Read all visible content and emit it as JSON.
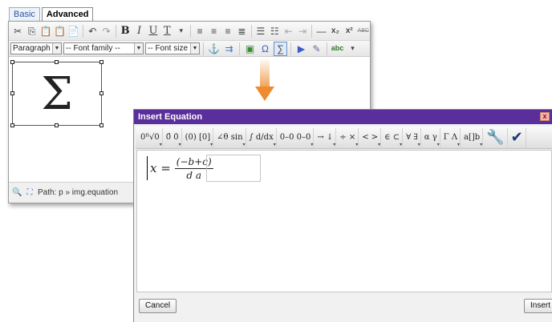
{
  "editor": {
    "tabs": [
      {
        "label": "Basic",
        "active": false
      },
      {
        "label": "Advanced",
        "active": true
      }
    ],
    "toolbar1": {
      "icons": [
        "cut-icon",
        "copy-icon",
        "paste-icon",
        "paste-text-icon",
        "paste-word-icon",
        "undo-icon",
        "redo-icon",
        "bold-icon",
        "italic-icon",
        "underline-icon",
        "font-color-icon",
        "align-left-icon",
        "align-center-icon",
        "align-right-icon",
        "align-justify-icon",
        "bullet-list-icon",
        "numbered-list-icon",
        "outdent-icon",
        "indent-icon",
        "horizontal-rule-icon",
        "subscript-icon",
        "superscript-icon",
        "strikethrough-icon"
      ],
      "bold_label": "B",
      "italic_label": "I",
      "underline_label": "U",
      "font_color_label": "T",
      "subscript_label": "x₂",
      "superscript_label": "x²",
      "strike_label": "ABC"
    },
    "toolbar2": {
      "paragraph_value": "Paragraph",
      "font_family_value": "-- Font family --",
      "font_size_value": "-- Font size --",
      "equation_glyph": "∑",
      "omega_glyph": "Ω",
      "spell_label": "abc"
    },
    "content": {
      "equation_symbol": "Σ"
    },
    "statusbar": {
      "path_text": "Path: p » img.equation"
    }
  },
  "dialog": {
    "title": "Insert Equation",
    "close_label": "x",
    "math_toolbar": [
      "0ᴮ√0",
      "0̄ 0̇",
      "(0) [0]",
      "∠θ sin",
      "∫ d/dx",
      "0–0 0–0",
      "→ ↓",
      "÷ ×",
      "< >",
      "∈ ⊂",
      "∀ ∃",
      "α γ",
      "Γ Λ",
      "a[]b"
    ],
    "equation": {
      "lhs": "x =",
      "numerator": "(−b+c)",
      "denominator": "d a"
    },
    "cancel_label": "Cancel",
    "insert_label": "Insert"
  }
}
